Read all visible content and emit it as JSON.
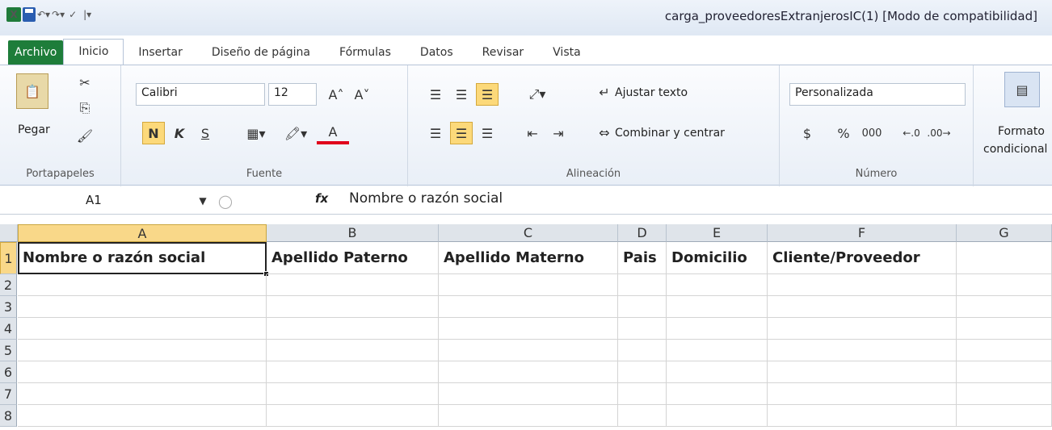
{
  "window_title": "carga_proveedoresExtranjerosIC(1)  [Modo de compatibilidad]",
  "tabs": [
    "Archivo",
    "Inicio",
    "Insertar",
    "Diseño de página",
    "Fórmulas",
    "Datos",
    "Revisar",
    "Vista"
  ],
  "ribbon": {
    "clipboard": {
      "paste_label": "Pegar",
      "group_label": "Portapapeles"
    },
    "font": {
      "name": "Calibri",
      "size": "12",
      "bold": "N",
      "italic": "K",
      "underline": "S",
      "color_a": "A",
      "group_label": "Fuente"
    },
    "alignment": {
      "wrap_label": "Ajustar texto",
      "merge_label": "Combinar y centrar",
      "group_label": "Alineación"
    },
    "number": {
      "format": "Personalizada",
      "currency": "$",
      "percent": "%",
      "thousands": "000",
      "group_label": "Número"
    },
    "styles": {
      "cond_format_label": "Formato",
      "cond_format_label2": "condicional"
    }
  },
  "formula_bar": {
    "name_box": "A1",
    "fx": "fx",
    "content": "Nombre o razón social"
  },
  "columns": [
    "A",
    "B",
    "C",
    "D",
    "E",
    "F",
    "G"
  ],
  "rows": [
    "1",
    "2",
    "3",
    "4",
    "5",
    "6",
    "7",
    "8"
  ],
  "row1": [
    "Nombre o razón social",
    "Apellido Paterno",
    "Apellido Materno",
    "Pais",
    "Domicilio",
    "Cliente/Proveedor",
    ""
  ],
  "colors": {
    "accent_green": "#1e7d3a",
    "selection": "#f9d889"
  }
}
